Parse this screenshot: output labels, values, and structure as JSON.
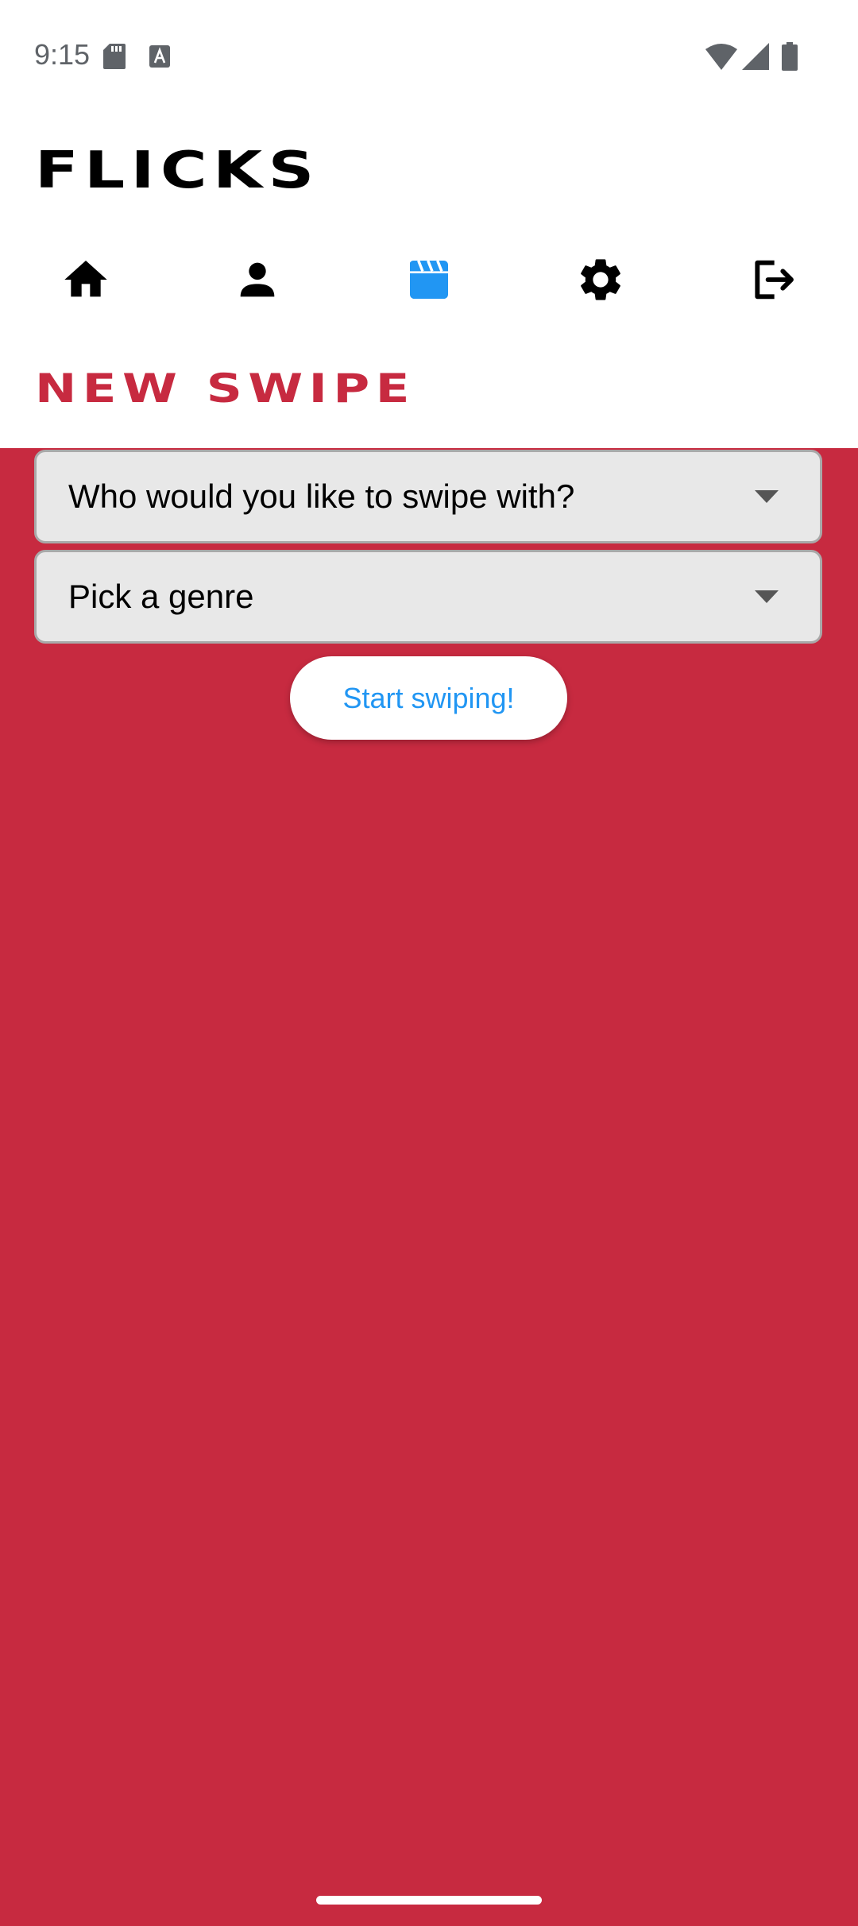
{
  "status_bar": {
    "time": "9:15",
    "icons": [
      "sd-card-icon",
      "a-badge-icon",
      "wifi-icon",
      "signal-icon",
      "battery-icon"
    ]
  },
  "app": {
    "title": "FLICKS"
  },
  "nav": {
    "items": [
      {
        "icon": "home-icon",
        "active": false
      },
      {
        "icon": "person-icon",
        "active": false
      },
      {
        "icon": "clapperboard-icon",
        "active": true
      },
      {
        "icon": "gear-icon",
        "active": false
      },
      {
        "icon": "logout-icon",
        "active": false
      }
    ],
    "active_color": "#2196f3",
    "inactive_color": "#000000"
  },
  "page": {
    "section_title": "NEW SWIPE",
    "friend_select": {
      "placeholder": "Who would you like to swipe with?"
    },
    "genre_select": {
      "placeholder": "Pick a genre"
    },
    "start_button": "Start swiping!"
  },
  "colors": {
    "background": "#c72a40",
    "accent": "#2196f3",
    "header_bg": "#ffffff"
  }
}
